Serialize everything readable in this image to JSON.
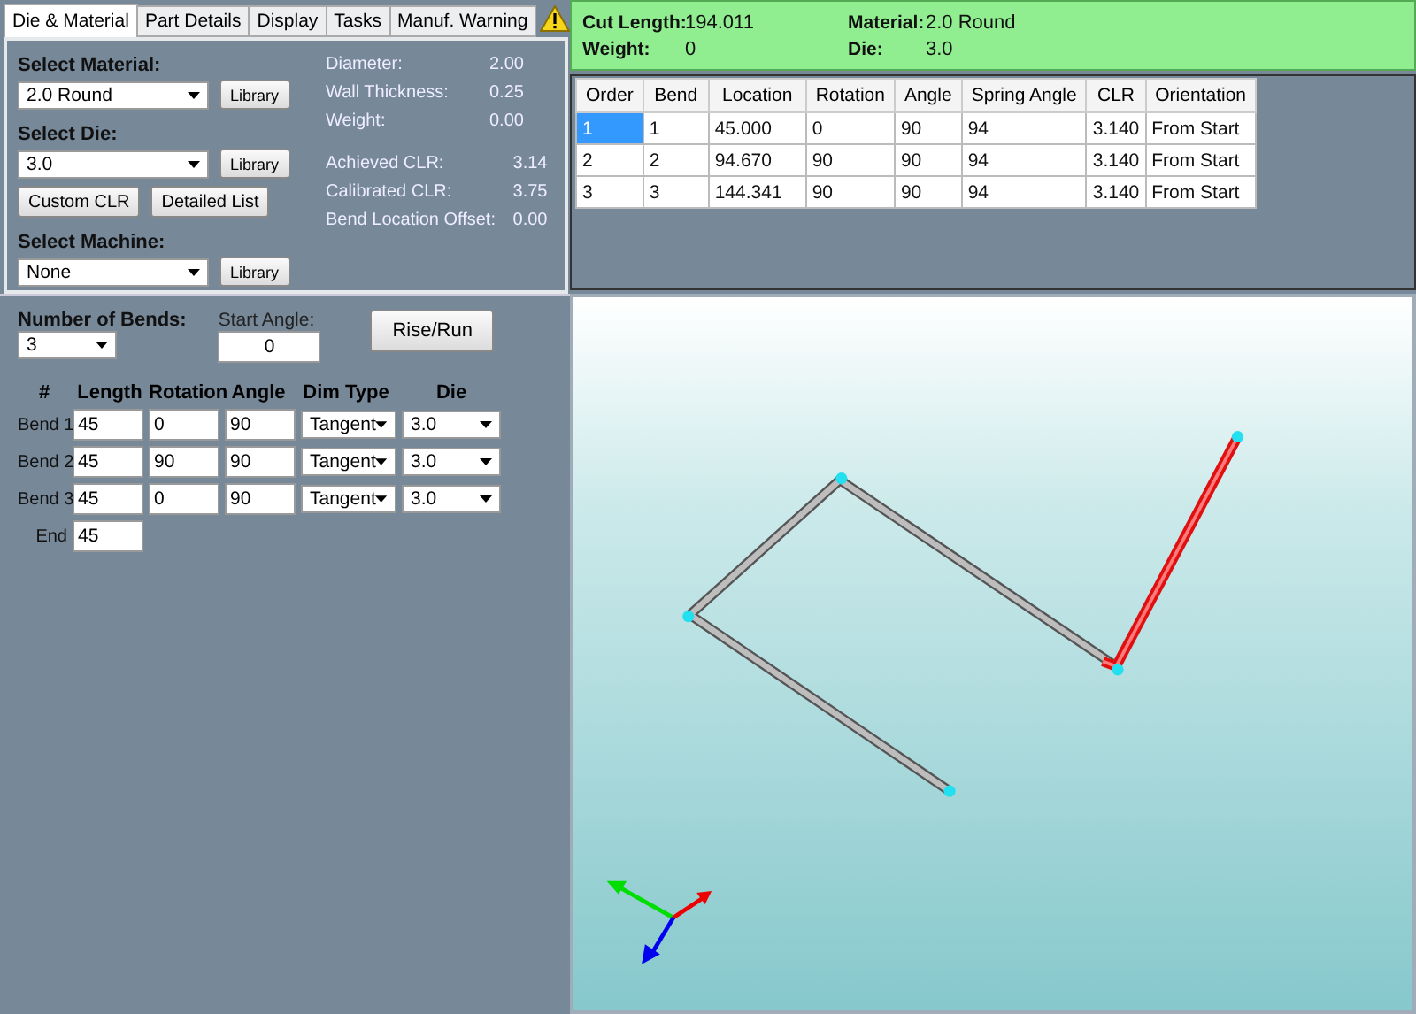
{
  "tabs": [
    {
      "label": "Die & Material",
      "selected": true
    },
    {
      "label": "Part Details",
      "selected": false
    },
    {
      "label": "Display",
      "selected": false
    },
    {
      "label": "Tasks",
      "selected": false
    },
    {
      "label": "Manuf. Warning",
      "selected": false
    }
  ],
  "selectors": [
    {
      "label": "Select Material:",
      "value": "2.0 Round",
      "button": "Library"
    },
    {
      "label": "Select Die:",
      "value": "3.0",
      "button": "Library",
      "extra_buttons": [
        "Custom CLR",
        "Detailed List"
      ]
    },
    {
      "label": "Select Machine:",
      "value": "None",
      "button": "Library"
    }
  ],
  "properties": [
    [
      {
        "label": "Diameter:",
        "value": "2.00"
      },
      {
        "label": "Wall Thickness:",
        "value": "0.25"
      },
      {
        "label": "Weight:",
        "value": "0.00"
      }
    ],
    [
      {
        "label": "Achieved CLR:",
        "value": "3.14"
      },
      {
        "label": "Calibrated CLR:",
        "value": "3.75"
      },
      {
        "label": "Bend Location Offset:",
        "value": "0.00"
      }
    ]
  ],
  "summary": [
    {
      "label": "Cut Length:",
      "value": "194.011"
    },
    {
      "label": "Material:",
      "value": "2.0 Round"
    },
    {
      "label": "Weight:",
      "value": "0"
    },
    {
      "label": "Die:",
      "value": "3.0"
    }
  ],
  "bend_table": {
    "columns": [
      "Order",
      "Bend",
      "Location",
      "Rotation",
      "Angle",
      "Spring Angle",
      "CLR",
      "Orientation"
    ],
    "rows": [
      {
        "cells": [
          "1",
          "1",
          "45.000",
          "0",
          "90",
          "94",
          "3.140",
          "From Start"
        ],
        "selected": true
      },
      {
        "cells": [
          "2",
          "2",
          "94.670",
          "90",
          "90",
          "94",
          "3.140",
          "From Start"
        ],
        "selected": false
      },
      {
        "cells": [
          "3",
          "3",
          "144.341",
          "90",
          "90",
          "94",
          "3.140",
          "From Start"
        ],
        "selected": false
      }
    ]
  },
  "bends": {
    "number_of_bends": {
      "label": "Number of Bends:",
      "value": "3"
    },
    "start_angle": {
      "label": "Start Angle:",
      "value": "0"
    },
    "rise_run_button": "Rise/Run",
    "columns": [
      "#",
      "Length",
      "Rotation",
      "Angle",
      "Dim Type",
      "Die"
    ],
    "rows": [
      {
        "label": "Bend 1",
        "length": "45",
        "rotation": "0",
        "angle": "90",
        "dim_type": "Tangent",
        "die": "3.0"
      },
      {
        "label": "Bend 2",
        "length": "45",
        "rotation": "90",
        "angle": "90",
        "dim_type": "Tangent",
        "die": "3.0"
      },
      {
        "label": "Bend 3",
        "length": "45",
        "rotation": "0",
        "angle": "90",
        "dim_type": "Tangent",
        "die": "3.0"
      }
    ],
    "end": {
      "label": "End",
      "length": "45"
    }
  }
}
